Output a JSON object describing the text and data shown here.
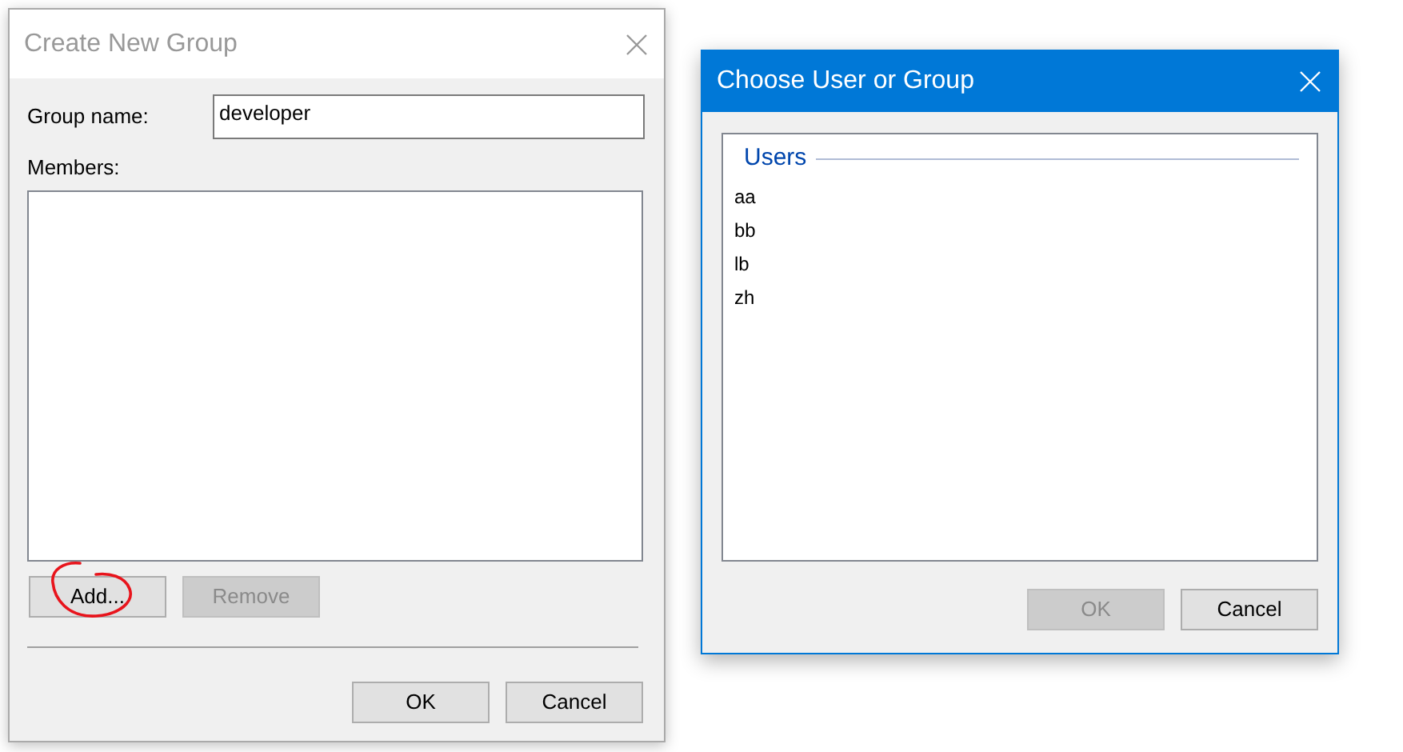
{
  "create_group_dialog": {
    "title": "Create New Group",
    "active": false,
    "group_name": {
      "label": "Group name:",
      "value": "developer"
    },
    "members": {
      "label": "Members:"
    },
    "list_buttons": [
      {
        "label": "Add...",
        "disabled": false,
        "circled": true
      },
      {
        "label": "Remove",
        "disabled": true,
        "circled": false
      }
    ],
    "buttons": [
      {
        "label": "OK",
        "disabled": false
      },
      {
        "label": "Cancel",
        "disabled": false
      }
    ]
  },
  "choose_dialog": {
    "title": "Choose User or Group",
    "active": true,
    "group_label": "Users",
    "users": [
      "aa",
      "bb",
      "lb",
      "zh"
    ],
    "buttons": [
      {
        "label": "OK",
        "disabled": true
      },
      {
        "label": "Cancel",
        "disabled": false
      }
    ]
  }
}
